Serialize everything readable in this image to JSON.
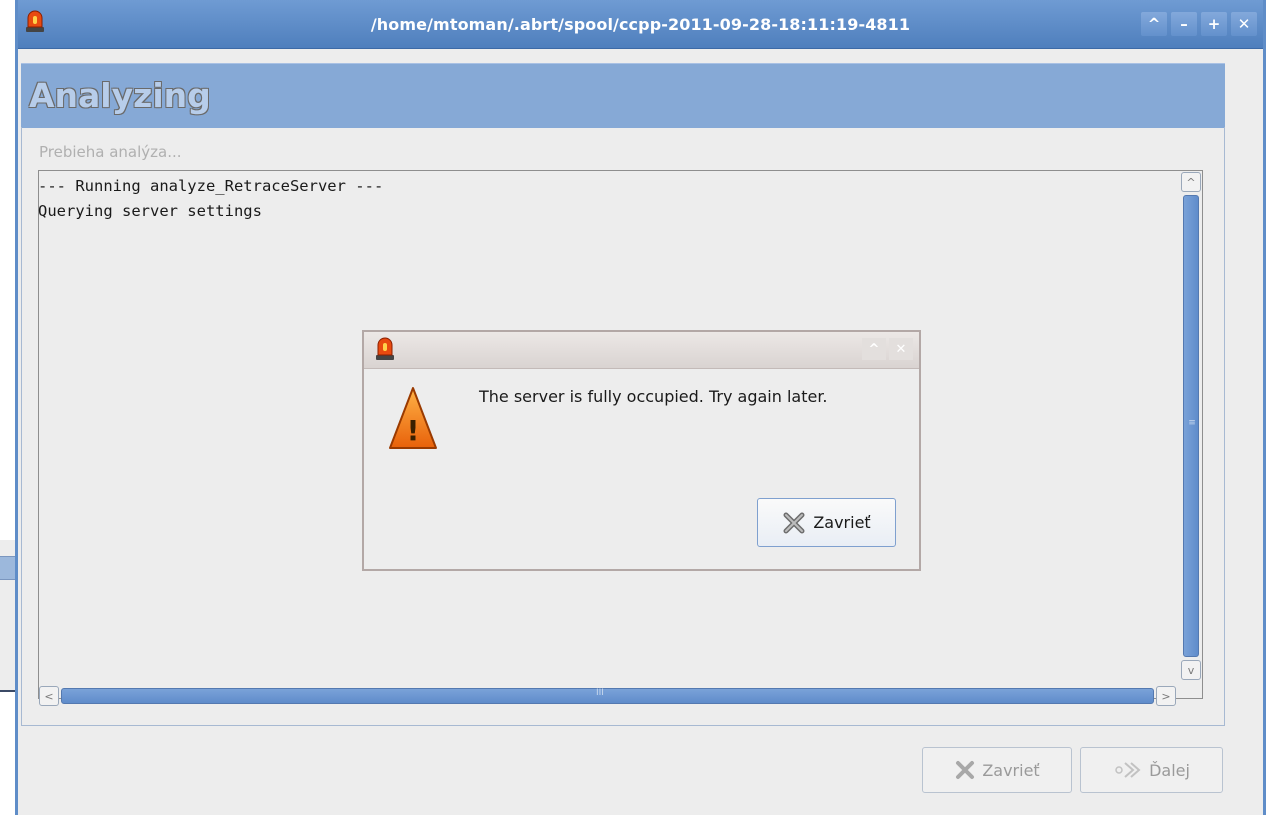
{
  "window": {
    "title": "/home/mtoman/.abrt/spool/ccpp-2011-09-28-18:11:19-4811",
    "controls": [
      "^",
      "–",
      "+",
      "✕"
    ]
  },
  "page": {
    "header": "Analyzing",
    "status_label": "Prebieha analýza...",
    "log_lines": "--- Running analyze_RetraceServer ---\nQuerying server settings"
  },
  "scrollbars": {
    "up_arrow": "^",
    "down_arrow": "v",
    "left_arrow": "<",
    "right_arrow": ">",
    "vgrip": "≡",
    "hgrip": "III"
  },
  "footer": {
    "close_label": "Zavrieť",
    "next_label": "Ďalej"
  },
  "dialog": {
    "message": "The server is fully occupied. Try again later.",
    "close_label": "Zavrieť",
    "controls": [
      "^",
      "✕"
    ]
  },
  "icons": {
    "app": "alarm-light-icon",
    "warning": "warning-triangle-icon",
    "close": "x-cross-icon",
    "next": "forward-arrow-icon"
  },
  "colors": {
    "titlebar": "#5a89c6",
    "header_band": "#86a9d6",
    "scroll_thumb": "#6b96d0",
    "warning_orange": "#f07a10"
  }
}
